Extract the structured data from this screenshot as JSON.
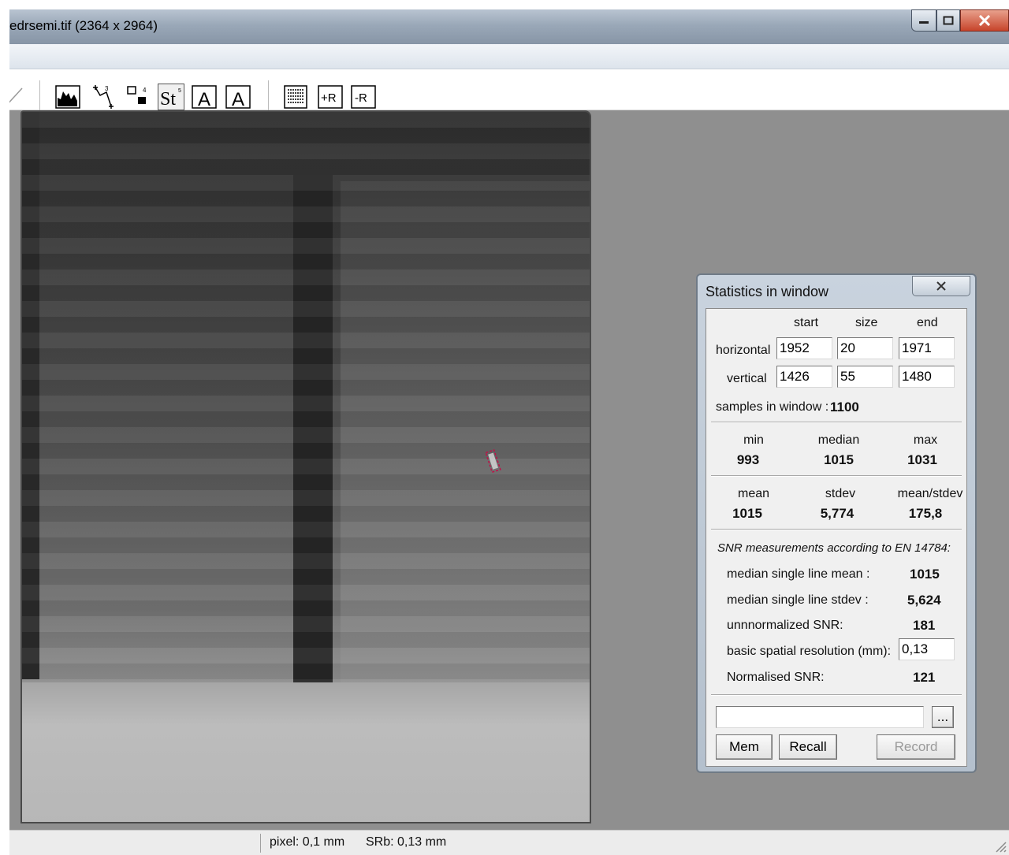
{
  "window": {
    "title": "edrsemi.tif (2364 x 2964)"
  },
  "status_bar": {
    "pixel": "pixel: 0,1 mm",
    "srb": "SRb: 0,13 mm"
  },
  "toolbar": {
    "icons": [
      "line-tool-icon",
      "histogram-icon",
      "point-tool-icon",
      "roi-tool-icon",
      "statistics-icon",
      "annotation-a-icon",
      "annotation-a2-icon",
      "report-icon",
      "add-roi-icon",
      "remove-roi-icon"
    ],
    "btn_st": "St",
    "btn_a1": "A",
    "btn_a2": "A",
    "btn_add_r": "+R",
    "btn_remove_r": "-R"
  },
  "stats_dialog": {
    "title": "Statistics in window",
    "col_start": "start",
    "col_size": "size",
    "col_end": "end",
    "horizontal_label": "horizontal",
    "vertical_label": "vertical",
    "horizontal": {
      "start": "1952",
      "size": "20",
      "end": "1971"
    },
    "vertical": {
      "start": "1426",
      "size": "55",
      "end": "1480"
    },
    "samples_label": "samples in window :",
    "samples_value": "1100",
    "min_label": "min",
    "min_value": "993",
    "median_label": "median",
    "median_value": "1015",
    "max_label": "max",
    "max_value": "1031",
    "mean_label": "mean",
    "mean_value": "1015",
    "stdev_label": "stdev",
    "stdev_value": "5,774",
    "mean_stdev_label": "mean/stdev",
    "mean_stdev_value": "175,8",
    "snr_heading": "SNR measurements according to EN 14784:",
    "median_line_mean_label": "median single line mean :",
    "median_line_mean_value": "1015",
    "median_line_stdev_label": "median single line stdev :",
    "median_line_stdev_value": "5,624",
    "unnormalized_snr_label": "unnnormalized SNR:",
    "unnormalized_snr_value": "181",
    "basic_resolution_label": "basic spatial resolution (mm):",
    "basic_resolution_value": "0,13",
    "normalised_snr_label": "Normalised SNR:",
    "normalised_snr_value": "121",
    "path_value": "",
    "browse_label": "...",
    "mem_label": "Mem",
    "recall_label": "Recall",
    "record_label": "Record"
  }
}
